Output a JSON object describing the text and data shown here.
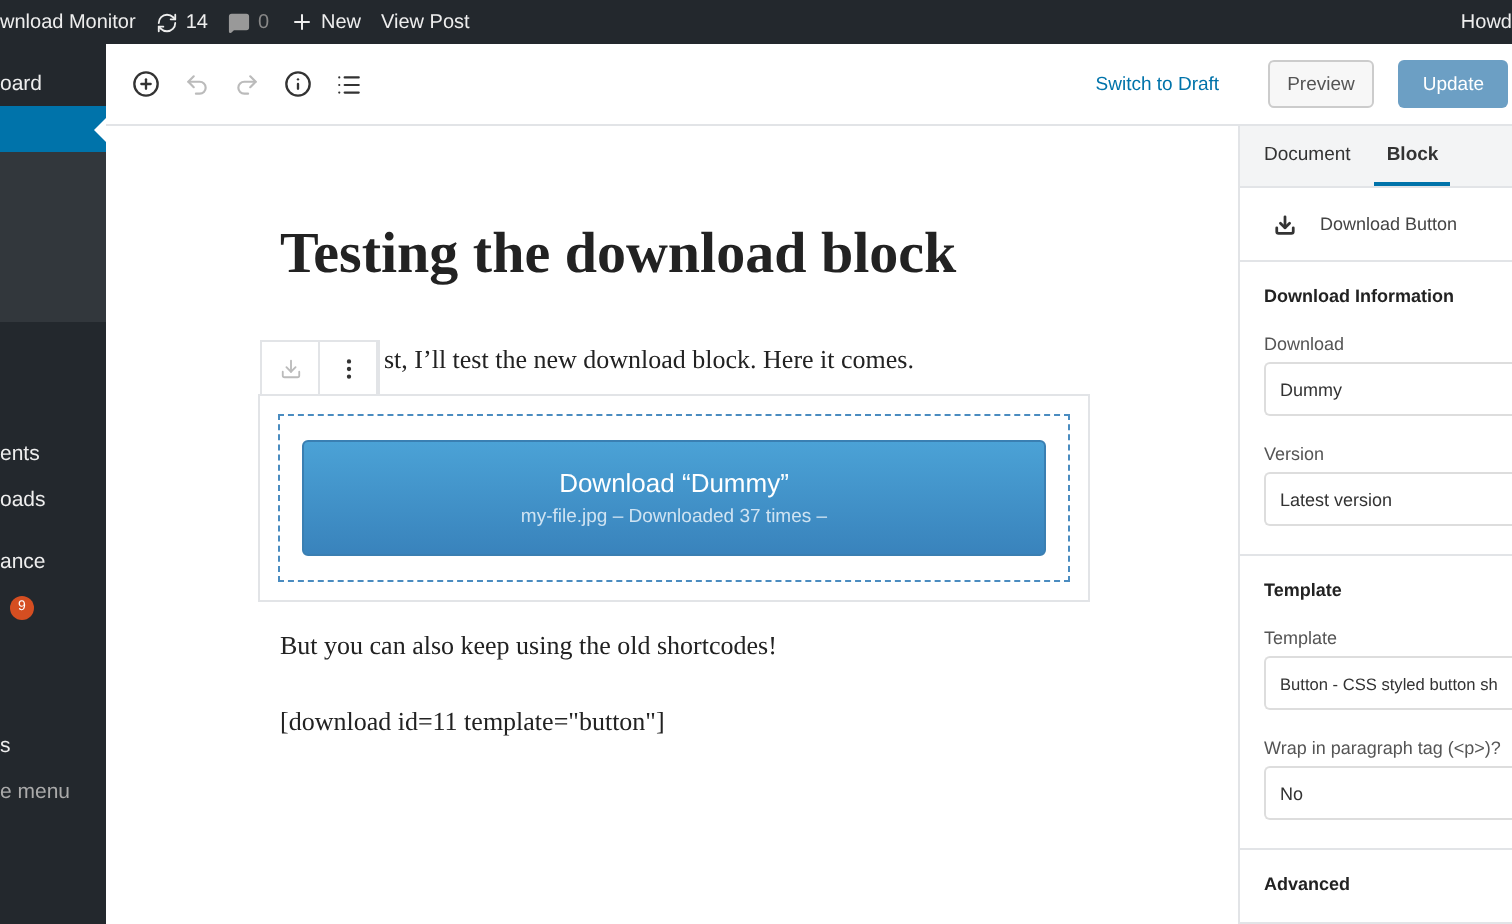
{
  "admin_bar": {
    "site": "wnload Monitor",
    "updates": "14",
    "comments": "0",
    "new": "New",
    "view_post": "View Post",
    "greeting": "Howd"
  },
  "sidebar": {
    "items": [
      {
        "kind": "label",
        "label": "oard",
        "selected": false
      },
      {
        "kind": "label",
        "selected": true
      },
      {
        "kind": "submenu"
      },
      {
        "kind": "label",
        "label": "ents",
        "selected": false
      },
      {
        "kind": "label",
        "label": "oads",
        "selected": false
      },
      {
        "kind": "label",
        "label": "ance",
        "selected": false
      },
      {
        "kind": "badge",
        "badge": "9"
      },
      {
        "kind": "label",
        "label": "s",
        "selected": false
      },
      {
        "kind": "collapse",
        "label": "e menu"
      }
    ]
  },
  "toolbar": {
    "undo_disabled": true,
    "redo_disabled": true,
    "switch_to_draft": "Switch to Draft",
    "preview": "Preview",
    "update": "Update",
    "update_disabled": true
  },
  "editor": {
    "title": "Testing the download block",
    "intro": "st, I’ll test the new download block. Here it comes.",
    "download_block": {
      "selected": true,
      "button_title": "Download “Dummy”",
      "button_meta": "my-file.jpg – Downloaded 37 times –"
    },
    "paragraphs": [
      "But you can also keep using the old shortcodes!",
      "[download id=11 template=\"button\"]"
    ]
  },
  "settings": {
    "tabs": [
      {
        "label": "Document",
        "selected": false
      },
      {
        "label": "Block",
        "selected": true
      }
    ],
    "block_name": "Download Button",
    "sections": [
      {
        "title": "Download Information",
        "fields": [
          {
            "label": "Download",
            "value": "Dummy"
          },
          {
            "label": "Version",
            "value": "Latest version"
          }
        ]
      },
      {
        "title": "Template",
        "fields": [
          {
            "label": "Template",
            "value": "Button - CSS styled button sh"
          },
          {
            "label": "Wrap in paragraph tag (<p>)?",
            "value": "No"
          }
        ]
      },
      {
        "title": "Advanced"
      }
    ]
  }
}
